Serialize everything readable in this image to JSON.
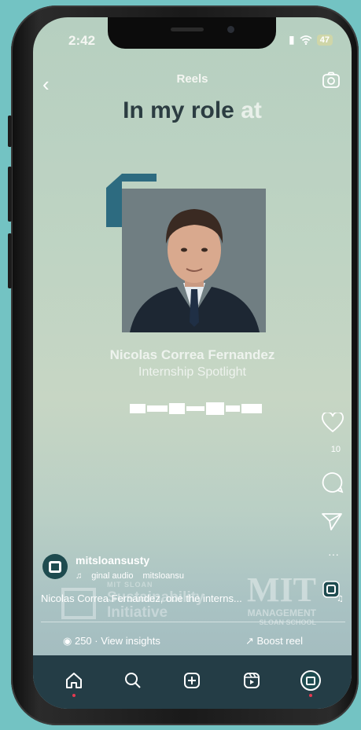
{
  "status_bar": {
    "time": "2:42",
    "battery": "47"
  },
  "header": {
    "back": "‹",
    "title": "Reels"
  },
  "video": {
    "headline_main": "In my role",
    "headline_faded": "at",
    "person_name": "Nicolas Correa Fernandez",
    "person_subtitle": "Internship Spotlight"
  },
  "actions": {
    "likes": "10",
    "more": "···"
  },
  "post": {
    "username": "mitsloansusty",
    "audio_label": "ginal audio",
    "audio_owner": "mitsloansu",
    "caption": "Nicolas Correa Fernandez, one the interns...",
    "views": "250 · View insights",
    "boost": "Boost reel"
  },
  "watermark": {
    "left_small": "MIT SLOAN",
    "left_line1": "Sustainability",
    "left_line2": "Initiative",
    "right_mit": "MIT",
    "right_mgmt": "MANAGEMENT",
    "right_school": "SLOAN SCHOOL"
  },
  "colors": {
    "accent": "#2d6b80",
    "navbar": "#243d46",
    "notification_dot": "#e53950"
  }
}
